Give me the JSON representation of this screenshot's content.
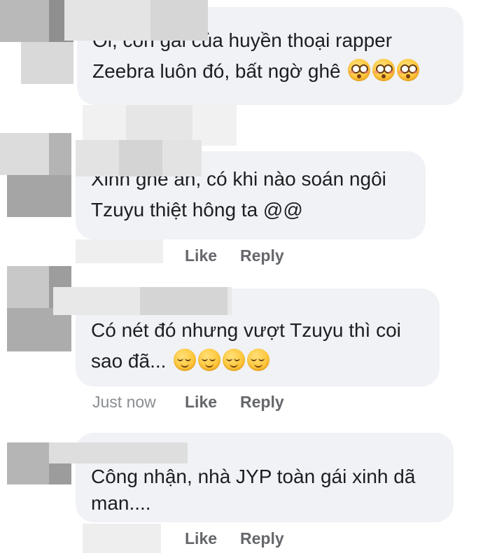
{
  "comments": [
    {
      "lines": [
        "Oi, con gái của huyền thoại rapper",
        "Zeebra luôn đó, bất ngờ ghê"
      ],
      "emoji": [
        "flushed-face-emoji",
        "flushed-face-emoji",
        "flushed-face-emoji"
      ]
    },
    {
      "lines": [
        "Xinh ghê ah, có khi nào soán ngôi",
        "Tzuyu thiệt hông ta @@"
      ],
      "actions": {
        "like": "Like",
        "reply": "Reply"
      }
    },
    {
      "lines": [
        "Có nét đó nhưng vượt Tzuyu thì coi",
        "sao đã..."
      ],
      "emoji": [
        "relieved-face-emoji",
        "relieved-face-emoji",
        "relieved-face-emoji",
        "relieved-face-emoji"
      ],
      "actions": {
        "time": "Just now",
        "like": "Like",
        "reply": "Reply"
      }
    },
    {
      "lines": [
        "Công nhận, nhà JYP toàn gái xinh dã",
        "man...."
      ],
      "actions": {
        "like": "Like",
        "reply": "Reply"
      }
    }
  ],
  "colors": {
    "bubble": "#f0f2f5",
    "text": "#1c1e21",
    "action": "#65676b",
    "timestamp": "#8a8d91"
  }
}
